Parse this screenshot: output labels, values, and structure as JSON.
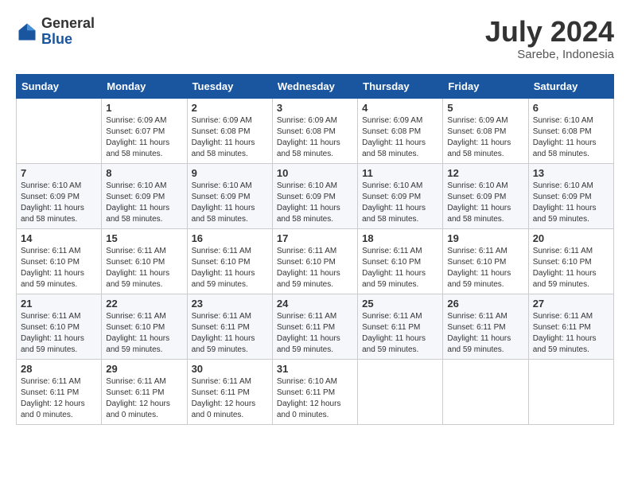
{
  "header": {
    "logo_general": "General",
    "logo_blue": "Blue",
    "month_title": "July 2024",
    "subtitle": "Sarebe, Indonesia"
  },
  "days_of_week": [
    "Sunday",
    "Monday",
    "Tuesday",
    "Wednesday",
    "Thursday",
    "Friday",
    "Saturday"
  ],
  "weeks": [
    [
      {
        "day": "",
        "sunrise": "",
        "sunset": "",
        "daylight": ""
      },
      {
        "day": "1",
        "sunrise": "Sunrise: 6:09 AM",
        "sunset": "Sunset: 6:07 PM",
        "daylight": "Daylight: 11 hours and 58 minutes."
      },
      {
        "day": "2",
        "sunrise": "Sunrise: 6:09 AM",
        "sunset": "Sunset: 6:08 PM",
        "daylight": "Daylight: 11 hours and 58 minutes."
      },
      {
        "day": "3",
        "sunrise": "Sunrise: 6:09 AM",
        "sunset": "Sunset: 6:08 PM",
        "daylight": "Daylight: 11 hours and 58 minutes."
      },
      {
        "day": "4",
        "sunrise": "Sunrise: 6:09 AM",
        "sunset": "Sunset: 6:08 PM",
        "daylight": "Daylight: 11 hours and 58 minutes."
      },
      {
        "day": "5",
        "sunrise": "Sunrise: 6:09 AM",
        "sunset": "Sunset: 6:08 PM",
        "daylight": "Daylight: 11 hours and 58 minutes."
      },
      {
        "day": "6",
        "sunrise": "Sunrise: 6:10 AM",
        "sunset": "Sunset: 6:08 PM",
        "daylight": "Daylight: 11 hours and 58 minutes."
      }
    ],
    [
      {
        "day": "7",
        "sunrise": "Sunrise: 6:10 AM",
        "sunset": "Sunset: 6:09 PM",
        "daylight": "Daylight: 11 hours and 58 minutes."
      },
      {
        "day": "8",
        "sunrise": "Sunrise: 6:10 AM",
        "sunset": "Sunset: 6:09 PM",
        "daylight": "Daylight: 11 hours and 58 minutes."
      },
      {
        "day": "9",
        "sunrise": "Sunrise: 6:10 AM",
        "sunset": "Sunset: 6:09 PM",
        "daylight": "Daylight: 11 hours and 58 minutes."
      },
      {
        "day": "10",
        "sunrise": "Sunrise: 6:10 AM",
        "sunset": "Sunset: 6:09 PM",
        "daylight": "Daylight: 11 hours and 58 minutes."
      },
      {
        "day": "11",
        "sunrise": "Sunrise: 6:10 AM",
        "sunset": "Sunset: 6:09 PM",
        "daylight": "Daylight: 11 hours and 58 minutes."
      },
      {
        "day": "12",
        "sunrise": "Sunrise: 6:10 AM",
        "sunset": "Sunset: 6:09 PM",
        "daylight": "Daylight: 11 hours and 58 minutes."
      },
      {
        "day": "13",
        "sunrise": "Sunrise: 6:10 AM",
        "sunset": "Sunset: 6:09 PM",
        "daylight": "Daylight: 11 hours and 59 minutes."
      }
    ],
    [
      {
        "day": "14",
        "sunrise": "Sunrise: 6:11 AM",
        "sunset": "Sunset: 6:10 PM",
        "daylight": "Daylight: 11 hours and 59 minutes."
      },
      {
        "day": "15",
        "sunrise": "Sunrise: 6:11 AM",
        "sunset": "Sunset: 6:10 PM",
        "daylight": "Daylight: 11 hours and 59 minutes."
      },
      {
        "day": "16",
        "sunrise": "Sunrise: 6:11 AM",
        "sunset": "Sunset: 6:10 PM",
        "daylight": "Daylight: 11 hours and 59 minutes."
      },
      {
        "day": "17",
        "sunrise": "Sunrise: 6:11 AM",
        "sunset": "Sunset: 6:10 PM",
        "daylight": "Daylight: 11 hours and 59 minutes."
      },
      {
        "day": "18",
        "sunrise": "Sunrise: 6:11 AM",
        "sunset": "Sunset: 6:10 PM",
        "daylight": "Daylight: 11 hours and 59 minutes."
      },
      {
        "day": "19",
        "sunrise": "Sunrise: 6:11 AM",
        "sunset": "Sunset: 6:10 PM",
        "daylight": "Daylight: 11 hours and 59 minutes."
      },
      {
        "day": "20",
        "sunrise": "Sunrise: 6:11 AM",
        "sunset": "Sunset: 6:10 PM",
        "daylight": "Daylight: 11 hours and 59 minutes."
      }
    ],
    [
      {
        "day": "21",
        "sunrise": "Sunrise: 6:11 AM",
        "sunset": "Sunset: 6:10 PM",
        "daylight": "Daylight: 11 hours and 59 minutes."
      },
      {
        "day": "22",
        "sunrise": "Sunrise: 6:11 AM",
        "sunset": "Sunset: 6:10 PM",
        "daylight": "Daylight: 11 hours and 59 minutes."
      },
      {
        "day": "23",
        "sunrise": "Sunrise: 6:11 AM",
        "sunset": "Sunset: 6:11 PM",
        "daylight": "Daylight: 11 hours and 59 minutes."
      },
      {
        "day": "24",
        "sunrise": "Sunrise: 6:11 AM",
        "sunset": "Sunset: 6:11 PM",
        "daylight": "Daylight: 11 hours and 59 minutes."
      },
      {
        "day": "25",
        "sunrise": "Sunrise: 6:11 AM",
        "sunset": "Sunset: 6:11 PM",
        "daylight": "Daylight: 11 hours and 59 minutes."
      },
      {
        "day": "26",
        "sunrise": "Sunrise: 6:11 AM",
        "sunset": "Sunset: 6:11 PM",
        "daylight": "Daylight: 11 hours and 59 minutes."
      },
      {
        "day": "27",
        "sunrise": "Sunrise: 6:11 AM",
        "sunset": "Sunset: 6:11 PM",
        "daylight": "Daylight: 11 hours and 59 minutes."
      }
    ],
    [
      {
        "day": "28",
        "sunrise": "Sunrise: 6:11 AM",
        "sunset": "Sunset: 6:11 PM",
        "daylight": "Daylight: 12 hours and 0 minutes."
      },
      {
        "day": "29",
        "sunrise": "Sunrise: 6:11 AM",
        "sunset": "Sunset: 6:11 PM",
        "daylight": "Daylight: 12 hours and 0 minutes."
      },
      {
        "day": "30",
        "sunrise": "Sunrise: 6:11 AM",
        "sunset": "Sunset: 6:11 PM",
        "daylight": "Daylight: 12 hours and 0 minutes."
      },
      {
        "day": "31",
        "sunrise": "Sunrise: 6:10 AM",
        "sunset": "Sunset: 6:11 PM",
        "daylight": "Daylight: 12 hours and 0 minutes."
      },
      {
        "day": "",
        "sunrise": "",
        "sunset": "",
        "daylight": ""
      },
      {
        "day": "",
        "sunrise": "",
        "sunset": "",
        "daylight": ""
      },
      {
        "day": "",
        "sunrise": "",
        "sunset": "",
        "daylight": ""
      }
    ]
  ]
}
